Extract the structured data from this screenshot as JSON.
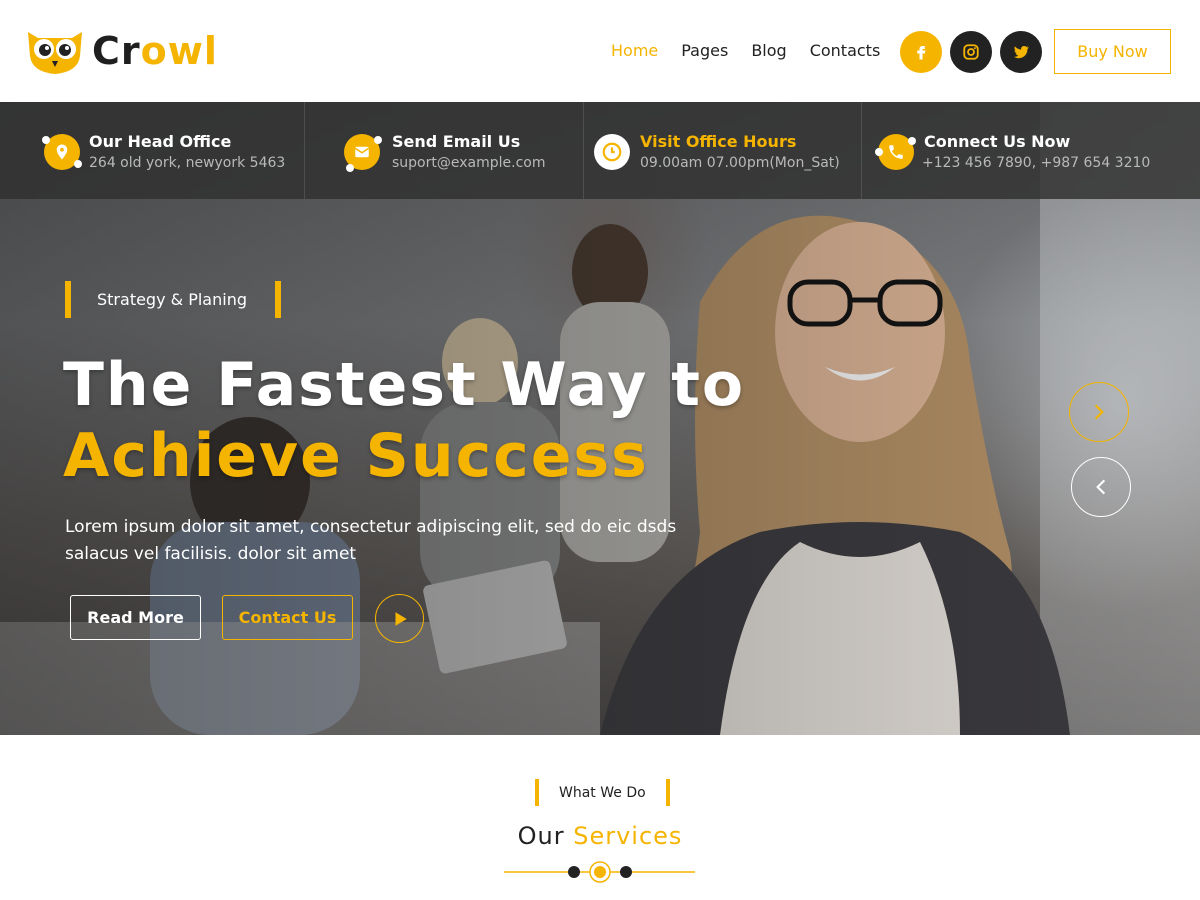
{
  "brand": {
    "part1": "Cr",
    "part2": "owl"
  },
  "nav": [
    {
      "label": "Home",
      "active": true
    },
    {
      "label": "Pages",
      "active": false
    },
    {
      "label": "Blog",
      "active": false
    },
    {
      "label": "Contacts",
      "active": false
    }
  ],
  "social": [
    {
      "icon": "facebook-icon",
      "color": "#f5b400"
    },
    {
      "icon": "instagram-icon",
      "color": "#222222"
    },
    {
      "icon": "twitter-icon",
      "color": "#222222"
    }
  ],
  "buy_button": "Buy Now",
  "info": [
    {
      "icon": "location-pin-icon",
      "title": "Our Head Office",
      "sub": "264 old york, newyork 5463"
    },
    {
      "icon": "email-icon",
      "title": "Send Email Us",
      "sub": "suport@example.com"
    },
    {
      "icon": "clock-icon",
      "title": "Visit Office Hours",
      "sub": "09.00am 07.00pm(Mon_Sat)"
    },
    {
      "icon": "phone-icon",
      "title": "Connect Us Now",
      "sub": "+123 456 7890, +987 654 3210"
    }
  ],
  "hero": {
    "tag": "Strategy & Planing",
    "headline_line1": "The Fastest Way to",
    "headline_line2": "Achieve Success",
    "text": "Lorem ipsum dolor sit amet, consectetur adipiscing elit, sed do eic dsds salacus vel facilisis. dolor sit amet",
    "read_more": "Read More",
    "contact_us": "Contact Us"
  },
  "services": {
    "tag": "What We Do",
    "title_part1": "Our",
    "title_part2": "Services"
  },
  "colors": {
    "accent": "#f5b400",
    "dark": "#222222"
  }
}
